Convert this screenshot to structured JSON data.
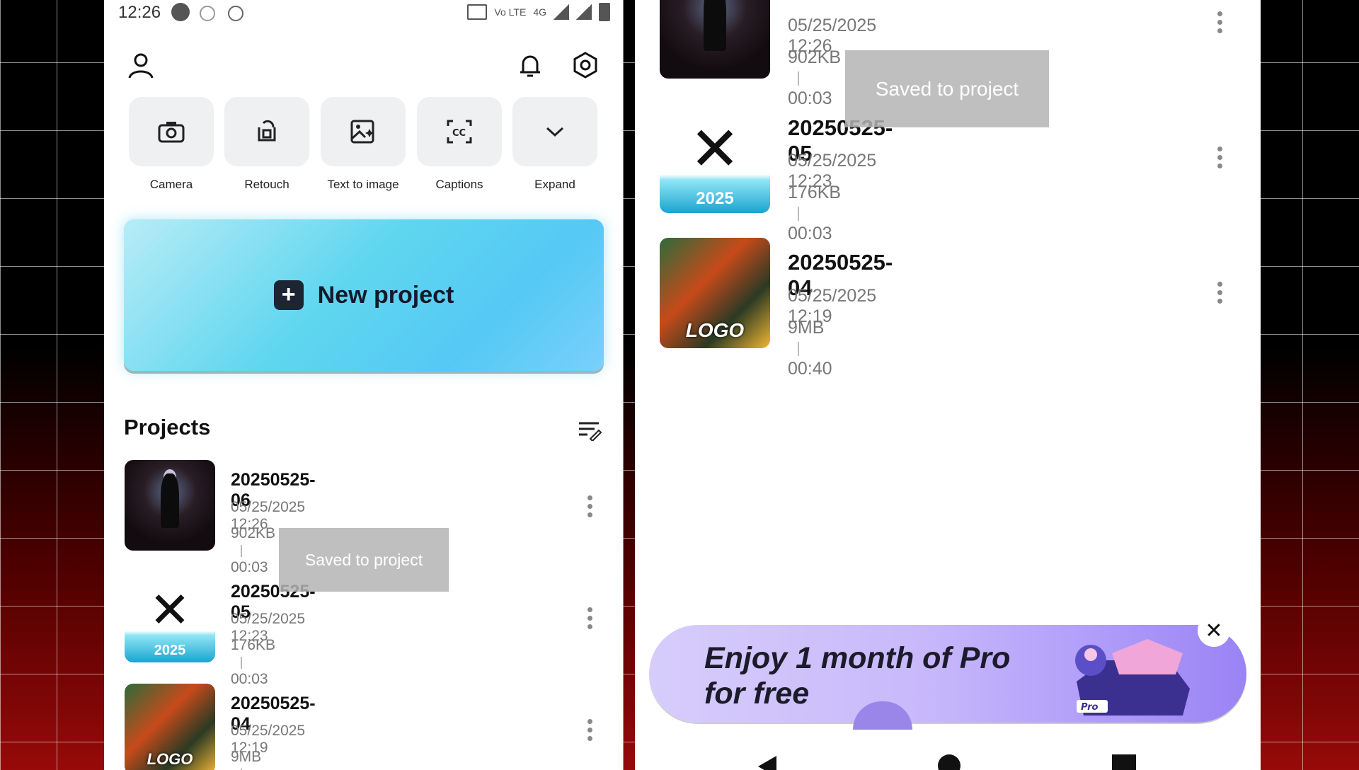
{
  "status": {
    "time": "12:26",
    "network": "4G",
    "volte": "Vo LTE"
  },
  "tools": [
    {
      "label": "Camera",
      "icon": "camera-icon"
    },
    {
      "label": "Retouch",
      "icon": "retouch-icon"
    },
    {
      "label": "Text to image",
      "icon": "text-to-image-icon"
    },
    {
      "label": "Captions",
      "icon": "captions-icon"
    },
    {
      "label": "Expand",
      "icon": "chevron-down-icon"
    }
  ],
  "new_project": {
    "label": "New project"
  },
  "projects": {
    "title": "Projects",
    "items": [
      {
        "name": "20250525-06",
        "date": "05/25/2025 12:26",
        "size": "902KB",
        "duration": "00:03"
      },
      {
        "name": "20250525-05",
        "date": "05/25/2025 12:23",
        "size": "176KB",
        "duration": "00:03",
        "badge": "2025"
      },
      {
        "name": "20250525-04",
        "date": "05/25/2025 12:19",
        "size": "9MB",
        "duration": "00:40",
        "badge": "LOGO"
      }
    ]
  },
  "toast": "Saved to project",
  "promo": {
    "line1": "Enjoy 1 month of Pro",
    "line2": "for free",
    "badge": "Pro"
  },
  "colors": {
    "accent": "#5fd6ef",
    "promo": "#c8b9fb",
    "toast": "#b4b4b4"
  }
}
